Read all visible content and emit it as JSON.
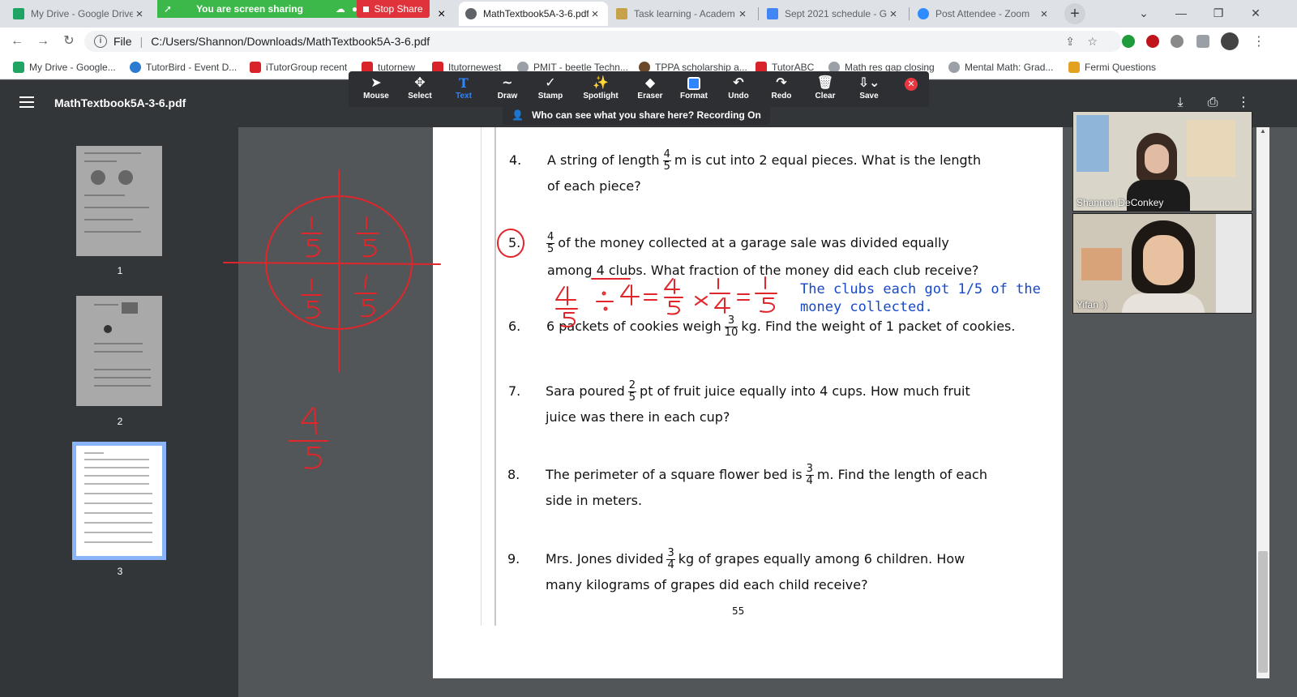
{
  "browser": {
    "tabs": [
      {
        "label": "My Drive - Google Drive",
        "icon_color": "#1fa463"
      },
      {
        "label": "MathTextbook5A-3-6.pdf",
        "icon_color": "#5f6368"
      },
      {
        "label": "Task learning - Academ",
        "icon_color": "#c8a24a"
      },
      {
        "label": "Sept 2021 schedule - G",
        "icon_color": "#4285f4"
      },
      {
        "label": "Post Attendee - Zoom",
        "icon_color": "#2d8cff"
      }
    ],
    "tab_close": "×",
    "new_tab": "+",
    "sharing_text": "You are screen sharing",
    "stop_share": "Stop Share",
    "url_scheme": "File",
    "url": "C:/Users/Shannon/Downloads/MathTextbook5A-3-6.pdf",
    "bookmarks": [
      "My Drive - Google...",
      "TutorBird - Event D...",
      "iTutorGroup recent",
      "tutornew",
      "Itutornewest",
      "PMIT - beetle Techn...",
      "TPPA scholarship a...",
      "TutorABC",
      "Math res gap closing",
      "Mental Math: Grad...",
      "Fermi Questions"
    ]
  },
  "pdf": {
    "title": "MathTextbook5A-3-6.pdf",
    "thumbnails": [
      "1",
      "2",
      "3"
    ],
    "page_number": "55"
  },
  "zoom_toolbar": {
    "tools": [
      "Mouse",
      "Select",
      "Text",
      "Draw",
      "Stamp",
      "Spotlight",
      "Eraser",
      "Format",
      "Undo",
      "Redo",
      "Clear",
      "Save"
    ],
    "selected": "Text",
    "who_can_see": "Who can see what you share here? Recording On"
  },
  "questions": [
    {
      "num": "4.",
      "pre": "A string of length",
      "frac": [
        "4",
        "5"
      ],
      "post": "m is cut into 2 equal pieces. What is the length",
      "line2": "of each piece?"
    },
    {
      "num": "5.",
      "pre": "",
      "frac": [
        "4",
        "5"
      ],
      "post": "of the money collected at a garage sale was divided equally",
      "line2": "among 4 clubs. What fraction of the money did each club receive?"
    },
    {
      "num": "6.",
      "pre": "6 packets of cookies weigh",
      "frac": [
        "3",
        "10"
      ],
      "post": "kg. Find the weight of 1 packet of cookies.",
      "line2": ""
    },
    {
      "num": "7.",
      "pre": "Sara poured",
      "frac": [
        "2",
        "5"
      ],
      "post": "pt of fruit juice equally into 4 cups. How much fruit",
      "line2": "juice was there in each cup?"
    },
    {
      "num": "8.",
      "pre": "The perimeter of a square flower bed is",
      "frac": [
        "3",
        "4"
      ],
      "post": "m. Find the length of each",
      "line2": "side in meters."
    },
    {
      "num": "9.",
      "pre": "Mrs. Jones divided",
      "frac": [
        "3",
        "4"
      ],
      "post": "kg of grapes equally among 6 children. How",
      "line2": "many kilograms of grapes did each child receive?"
    }
  ],
  "typed_annotation": {
    "line1": "The clubs each got 1/5 of the",
    "line2": "money collected."
  },
  "handwriting": {
    "circle_fractions": [
      "1/5",
      "1/5",
      "1/5",
      "1/5"
    ],
    "side_fraction": "4/5",
    "equation": "4/5 ÷ 4 = 4/5 × 1/4 = 1/5",
    "color": "#e0262b"
  },
  "video": {
    "participants": [
      {
        "name": "Shannon DeConkey"
      },
      {
        "name": "Yifan :)"
      }
    ]
  }
}
